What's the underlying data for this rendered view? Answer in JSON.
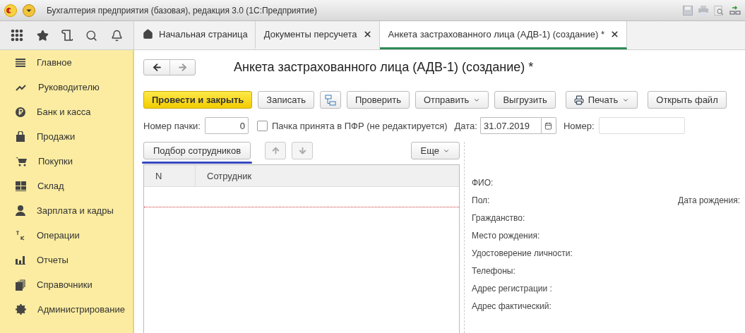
{
  "window": {
    "title": "Бухгалтерия предприятия (базовая), редакция 3.0  (1С:Предприятие)"
  },
  "tabs": [
    {
      "label": "Начальная страница",
      "selected": false,
      "kind": "home"
    },
    {
      "label": "Документы персучета",
      "selected": false,
      "kind": "closable"
    },
    {
      "label": "Анкета застрахованного лица (АДВ-1) (создание) *",
      "selected": true,
      "kind": "closable"
    }
  ],
  "sidebar": {
    "items": [
      {
        "label": "Главное"
      },
      {
        "label": "Руководителю"
      },
      {
        "label": "Банк и касса"
      },
      {
        "label": "Продажи"
      },
      {
        "label": "Покупки"
      },
      {
        "label": "Склад"
      },
      {
        "label": "Зарплата и кадры"
      },
      {
        "label": "Операции"
      },
      {
        "label": "Отчеты"
      },
      {
        "label": "Справочники"
      },
      {
        "label": "Администрирование"
      }
    ]
  },
  "form": {
    "title": "Анкета застрахованного лица (АДВ-1) (создание) *",
    "buttons": [
      {
        "label": "Провести и закрыть",
        "kind": "primary"
      },
      {
        "label": "Записать",
        "kind": "plain"
      },
      {
        "kind": "structure"
      },
      {
        "label": "Проверить",
        "kind": "plain"
      },
      {
        "label": "Отправить",
        "kind": "dropdown"
      },
      {
        "label": "Выгрузить",
        "kind": "plain"
      },
      {
        "label": "Печать",
        "kind": "print"
      },
      {
        "label": "Открыть файл",
        "kind": "plain"
      }
    ],
    "batch_number": {
      "label": "Номер пачки:",
      "value": "0"
    },
    "accepted": {
      "label": "Пачка принята в ПФР (не редактируется)",
      "checked": false
    },
    "date": {
      "label": "Дата:",
      "value": "31.07.2019"
    },
    "number": {
      "label": "Номер:"
    },
    "pick_button": {
      "label": "Подбор сотрудников"
    },
    "more_button": {
      "label": "Еще"
    },
    "table": {
      "columns": [
        "N",
        "Сотрудник"
      ]
    },
    "details": {
      "labels": [
        "ФИО:",
        "Пол:",
        "Гражданство:",
        "Место рождения:",
        "Удостоверение личности:",
        "Телефоны:",
        "Адрес регистрации :",
        "Адрес фактический:"
      ],
      "birth_date_label": "Дата рождения:"
    }
  }
}
